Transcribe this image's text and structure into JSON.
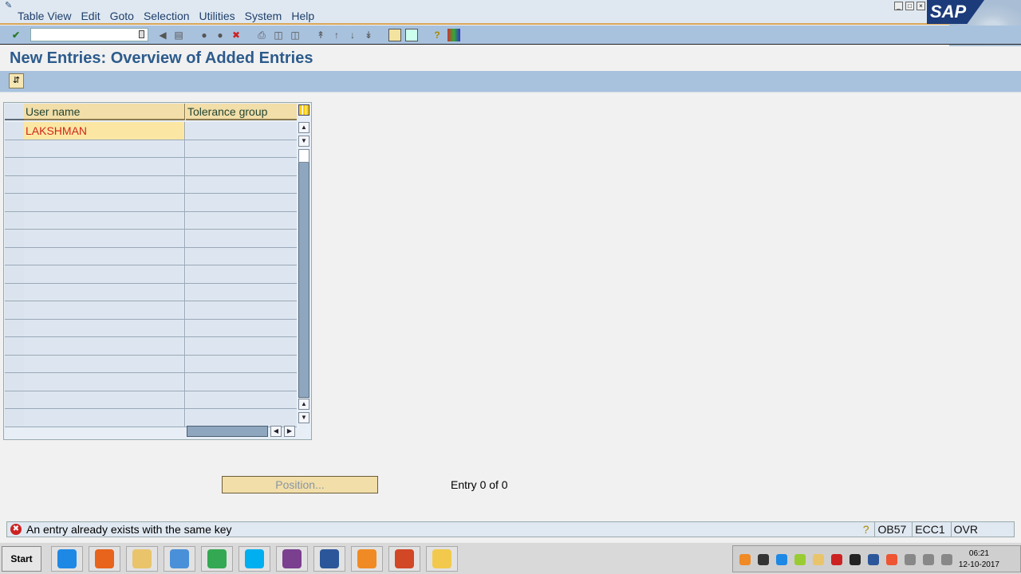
{
  "menu": [
    "Table View",
    "Edit",
    "Goto",
    "Selection",
    "Utilities",
    "System",
    "Help"
  ],
  "window_controls": [
    "minimize",
    "restore",
    "close"
  ],
  "logo": "SAP",
  "command_field": {
    "value": "",
    "placeholder": ""
  },
  "toolbar_icons": [
    "enter-icon",
    "back-icon",
    "save-icon",
    "back-nav-icon",
    "exit-icon",
    "cancel-icon",
    "print-icon",
    "find-icon",
    "find-next-icon",
    "first-page-icon",
    "previous-page-icon",
    "next-page-icon",
    "last-page-icon",
    "create-session-icon",
    "shortcut-icon",
    "help-icon",
    "customize-layout-icon"
  ],
  "page_title": "New Entries: Overview of Added Entries",
  "table": {
    "columns": [
      "User name",
      "Tolerance group"
    ],
    "rows": [
      {
        "user_name": "LAKSHMAN",
        "tolerance_group": ""
      },
      {
        "user_name": "",
        "tolerance_group": ""
      },
      {
        "user_name": "",
        "tolerance_group": ""
      },
      {
        "user_name": "",
        "tolerance_group": ""
      },
      {
        "user_name": "",
        "tolerance_group": ""
      },
      {
        "user_name": "",
        "tolerance_group": ""
      },
      {
        "user_name": "",
        "tolerance_group": ""
      },
      {
        "user_name": "",
        "tolerance_group": ""
      },
      {
        "user_name": "",
        "tolerance_group": ""
      },
      {
        "user_name": "",
        "tolerance_group": ""
      },
      {
        "user_name": "",
        "tolerance_group": ""
      },
      {
        "user_name": "",
        "tolerance_group": ""
      },
      {
        "user_name": "",
        "tolerance_group": ""
      },
      {
        "user_name": "",
        "tolerance_group": ""
      },
      {
        "user_name": "",
        "tolerance_group": ""
      },
      {
        "user_name": "",
        "tolerance_group": ""
      },
      {
        "user_name": "",
        "tolerance_group": ""
      }
    ]
  },
  "position_button": "Position...",
  "entry_counter": "Entry 0 of 0",
  "status": {
    "message": "An entry already exists with the same key",
    "transaction": "OB57",
    "system": "ECC1",
    "mode": "OVR"
  },
  "taskbar": {
    "start": "Start",
    "apps": [
      "Internet Explorer",
      "Firefox",
      "File Explorer",
      "Media Player",
      "Chrome",
      "Skype",
      "WinRAR",
      "Word",
      "App",
      "PowerPoint",
      "SAP Logon"
    ],
    "time": "06:21",
    "date": "12-10-2017"
  },
  "colors": {
    "accent": "#2d5b8c",
    "toolbar": "#a8c2de",
    "header": "#f2dea8",
    "error": "#cc2222",
    "entry_text": "#d1261e"
  }
}
